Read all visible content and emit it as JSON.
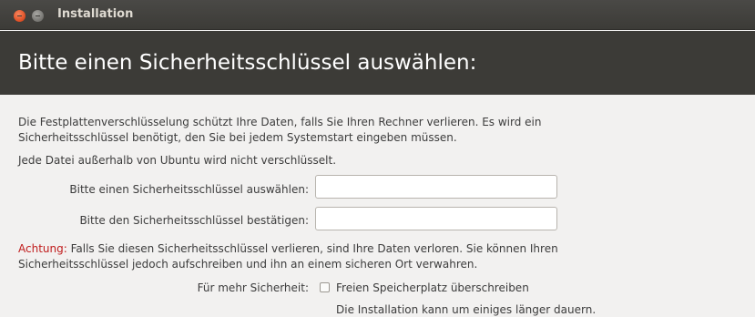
{
  "window": {
    "title": "Installation"
  },
  "header": {
    "title": "Bitte einen Sicherheitsschlüssel auswählen:"
  },
  "intro": {
    "line1": "Die Festplattenverschlüsselung schützt Ihre Daten, falls Sie Ihren Rechner verlieren. Es wird ein",
    "line2": "Sicherheitsschlüssel benötigt, den Sie bei jedem Systemstart eingeben müssen.",
    "line3": "Jede Datei außerhalb von Ubuntu wird nicht verschlüsselt."
  },
  "form": {
    "key_label": "Bitte einen Sicherheitsschlüssel auswählen:",
    "key_value": "",
    "confirm_label": "Bitte den Sicherheitsschlüssel bestätigen:",
    "confirm_value": ""
  },
  "warning": {
    "prefix": "Achtung:",
    "line1_rest": " Falls Sie diesen Sicherheitsschlüssel verlieren, sind Ihre Daten verloren. Sie können Ihren",
    "line2": "Sicherheitsschlüssel jedoch aufschreiben und ihn an einem sicheren Ort verwahren."
  },
  "security": {
    "label": "Für mehr Sicherheit:",
    "checkbox_label": "Freien Speicherplatz überschreiben",
    "checkbox_checked": false,
    "note": "Die Installation kann um einiges länger dauern."
  },
  "colors": {
    "header_bg": "#3c3b37",
    "warning": "#c01c1c",
    "close_button": "#e2542a"
  }
}
